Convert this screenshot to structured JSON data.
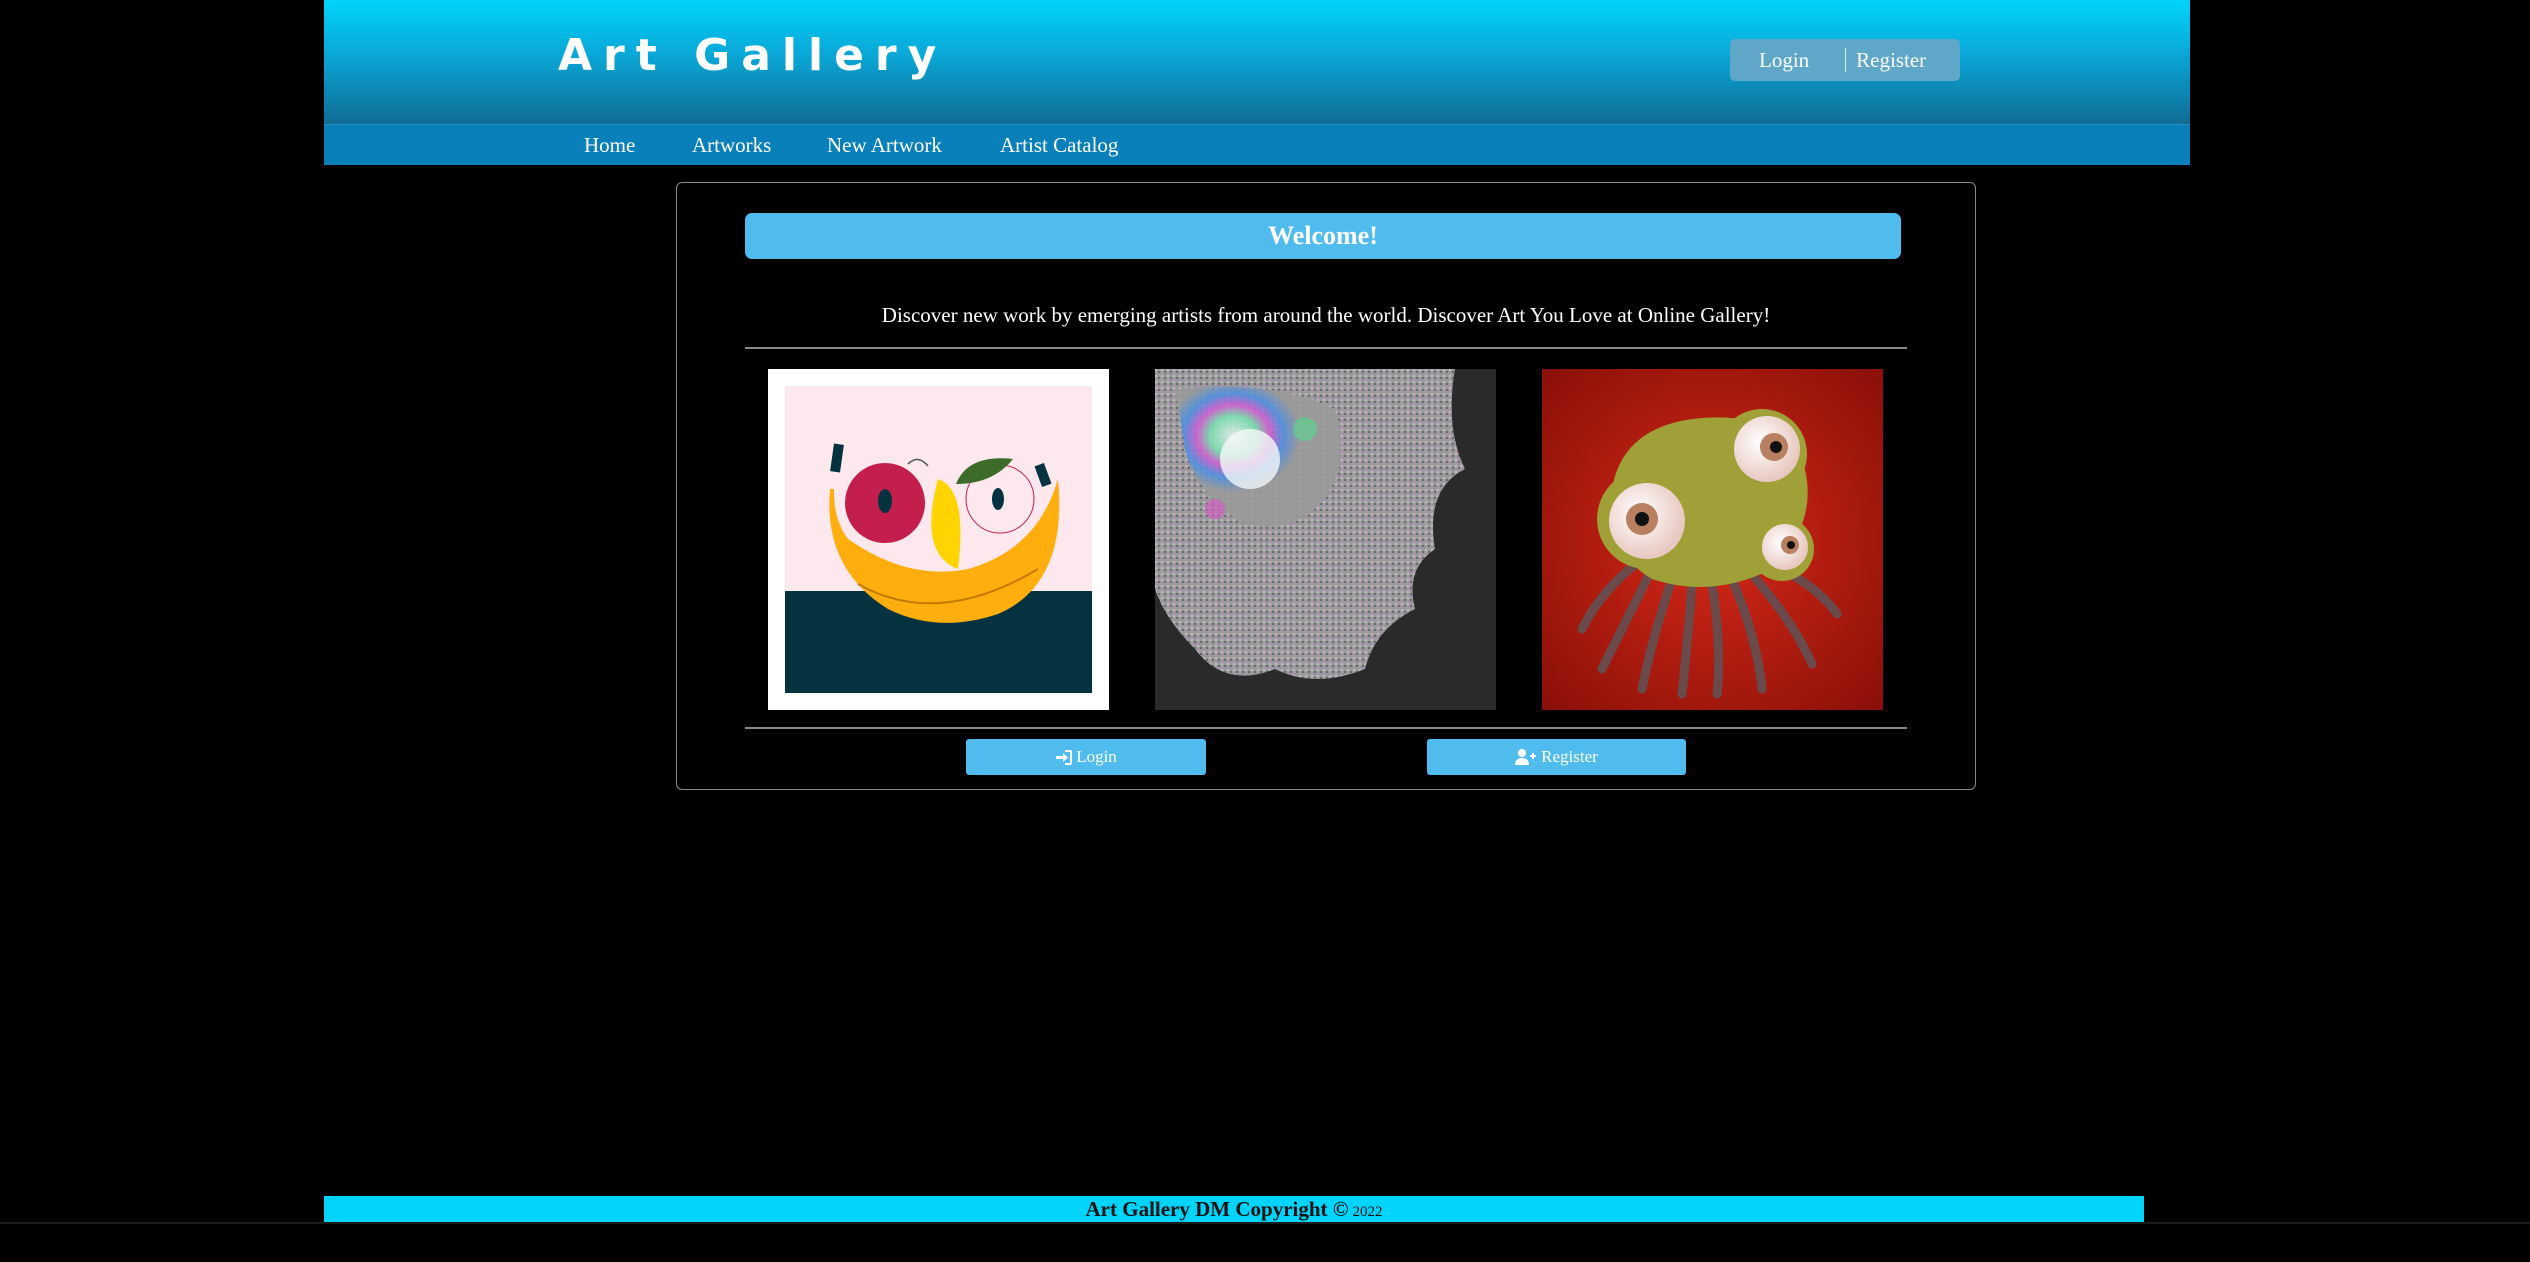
{
  "header": {
    "site_title": "Art Gallery",
    "login": "Login",
    "register": "Register"
  },
  "nav": {
    "items": [
      {
        "label": "Home"
      },
      {
        "label": "Artworks"
      },
      {
        "label": "New Artwork"
      },
      {
        "label": "Artist Catalog"
      }
    ]
  },
  "main": {
    "welcome": "Welcome!",
    "tagline": "Discover new work by emerging artists from around the world. Discover Art You Love at Online Gallery!",
    "artworks": [
      {
        "icon": "fruit-bowl-painting"
      },
      {
        "icon": "fractal-art"
      },
      {
        "icon": "eyeball-creature-painting"
      }
    ],
    "login_button": "Login",
    "register_button": "Register"
  },
  "footer": {
    "text": "Art Gallery DM Copyright ©",
    "year": "2022"
  },
  "colors": {
    "header_top": "#00d4fb",
    "header_bottom": "#0f6c95",
    "nav": "#0a80ba",
    "accent": "#50bcee",
    "footer": "#00d4fb"
  }
}
